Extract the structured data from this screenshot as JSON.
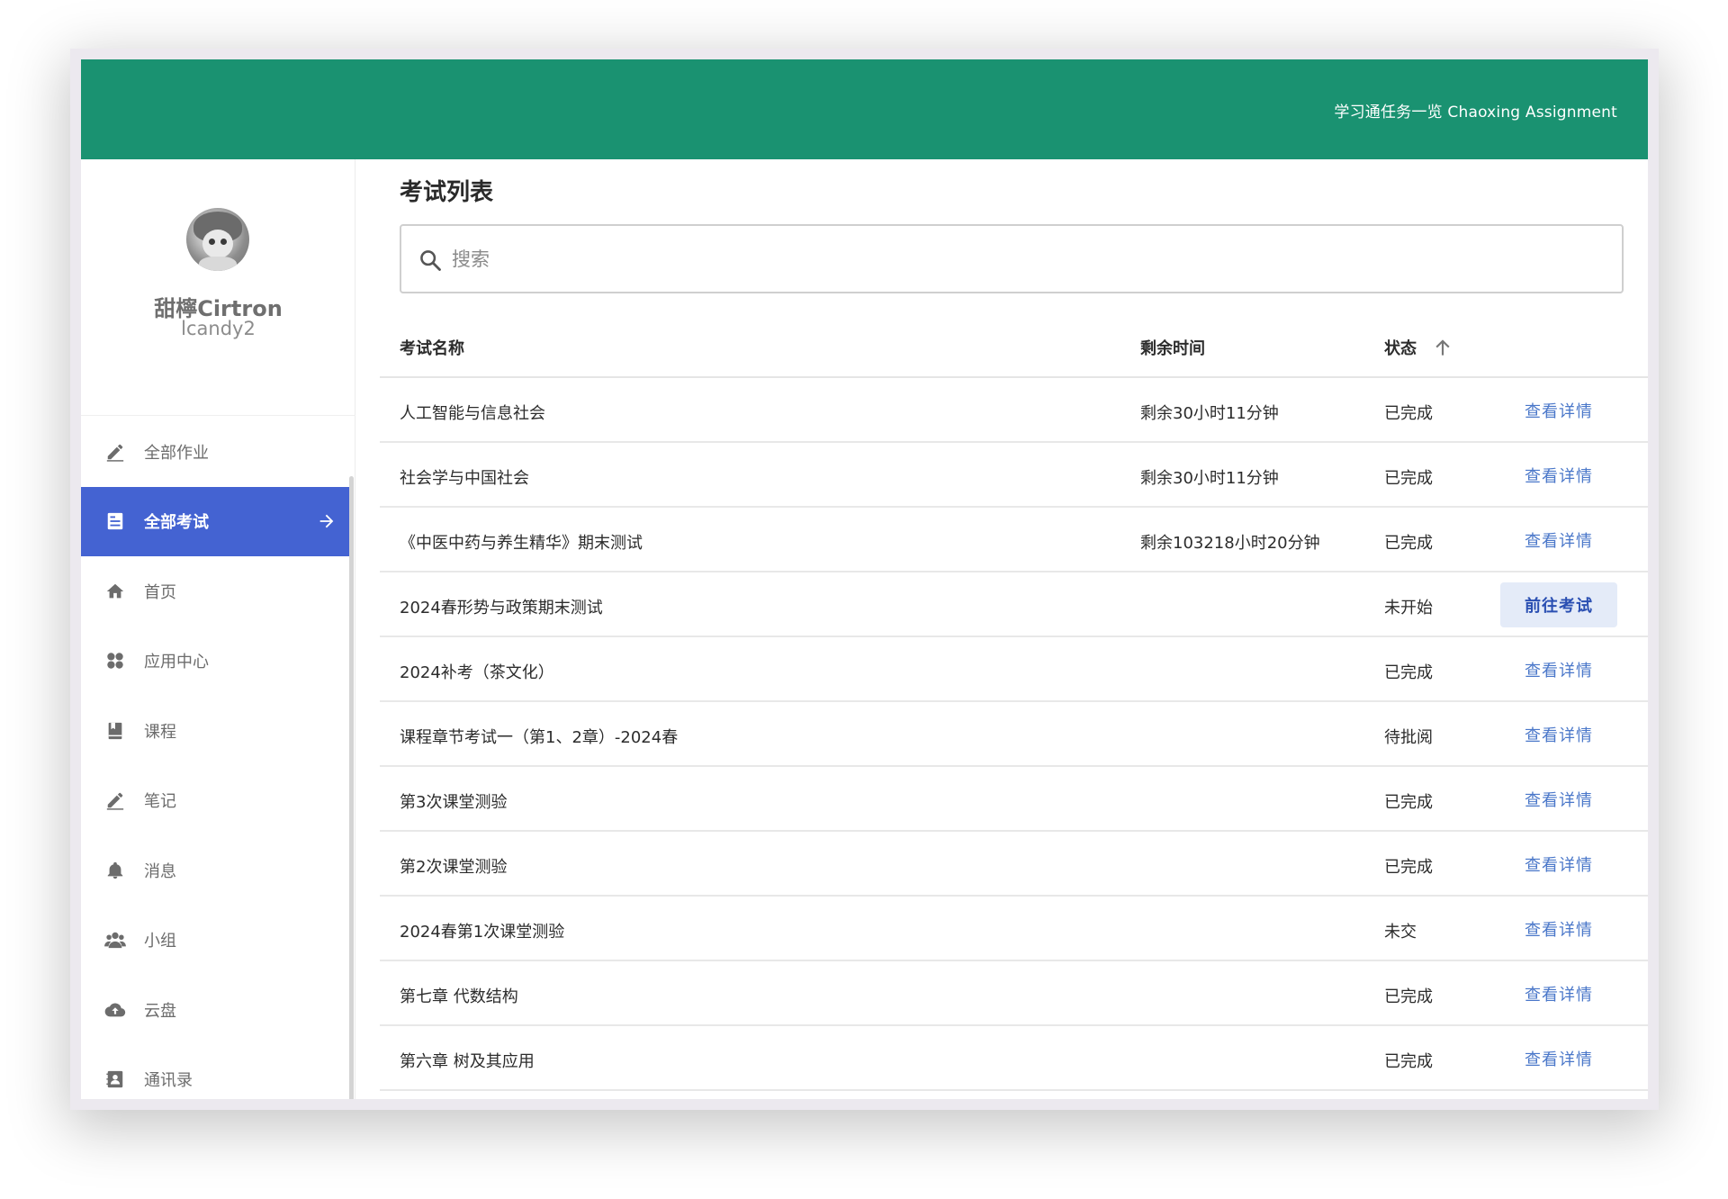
{
  "header": {
    "brand": "学习通任务一览 Chaoxing Assignment"
  },
  "user": {
    "name": "甜檸Cirtron",
    "id": "lcandy2"
  },
  "sidebar": {
    "items": [
      {
        "label": "全部作业",
        "icon": "edit-icon",
        "active": false
      },
      {
        "label": "全部考试",
        "icon": "exam-icon",
        "active": true
      },
      {
        "label": "首页",
        "icon": "home-icon",
        "active": false
      },
      {
        "label": "应用中心",
        "icon": "apps-icon",
        "active": false
      },
      {
        "label": "课程",
        "icon": "book-icon",
        "active": false
      },
      {
        "label": "笔记",
        "icon": "note-icon",
        "active": false
      },
      {
        "label": "消息",
        "icon": "bell-icon",
        "active": false
      },
      {
        "label": "小组",
        "icon": "group-icon",
        "active": false
      },
      {
        "label": "云盘",
        "icon": "cloud-upload-icon",
        "active": false
      },
      {
        "label": "通讯录",
        "icon": "contacts-icon",
        "active": false
      }
    ]
  },
  "main": {
    "title": "考试列表",
    "search": {
      "placeholder": "搜索",
      "value": ""
    },
    "table": {
      "headers": {
        "name": "考试名称",
        "time": "剩余时间",
        "status": "状态"
      },
      "rows": [
        {
          "name": "人工智能与信息社会",
          "time": "剩余30小时11分钟",
          "status": "已完成",
          "action": "查看详情"
        },
        {
          "name": "社会学与中国社会",
          "time": "剩余30小时11分钟",
          "status": "已完成",
          "action": "查看详情"
        },
        {
          "name": "《中医中药与养生精华》期末测试",
          "time": "剩余103218小时20分钟",
          "status": "已完成",
          "action": "查看详情"
        },
        {
          "name": "2024春形势与政策期末测试",
          "time": "",
          "status": "未开始",
          "action": "前往考试"
        },
        {
          "name": "2024补考（茶文化）",
          "time": "",
          "status": "已完成",
          "action": "查看详情"
        },
        {
          "name": "课程章节考试一（第1、2章）-2024春",
          "time": "",
          "status": "待批阅",
          "action": "查看详情"
        },
        {
          "name": "第3次课堂测验",
          "time": "",
          "status": "已完成",
          "action": "查看详情"
        },
        {
          "name": "第2次课堂测验",
          "time": "",
          "status": "已完成",
          "action": "查看详情"
        },
        {
          "name": "2024春第1次课堂测验",
          "time": "",
          "status": "未交",
          "action": "查看详情"
        },
        {
          "name": "第七章 代数结构",
          "time": "",
          "status": "已完成",
          "action": "查看详情"
        },
        {
          "name": "第六章 树及其应用",
          "time": "",
          "status": "已完成",
          "action": "查看详情"
        }
      ]
    }
  },
  "colors": {
    "header": "#1a9271",
    "active_nav": "#4463d2",
    "link": "#4a77c9"
  }
}
